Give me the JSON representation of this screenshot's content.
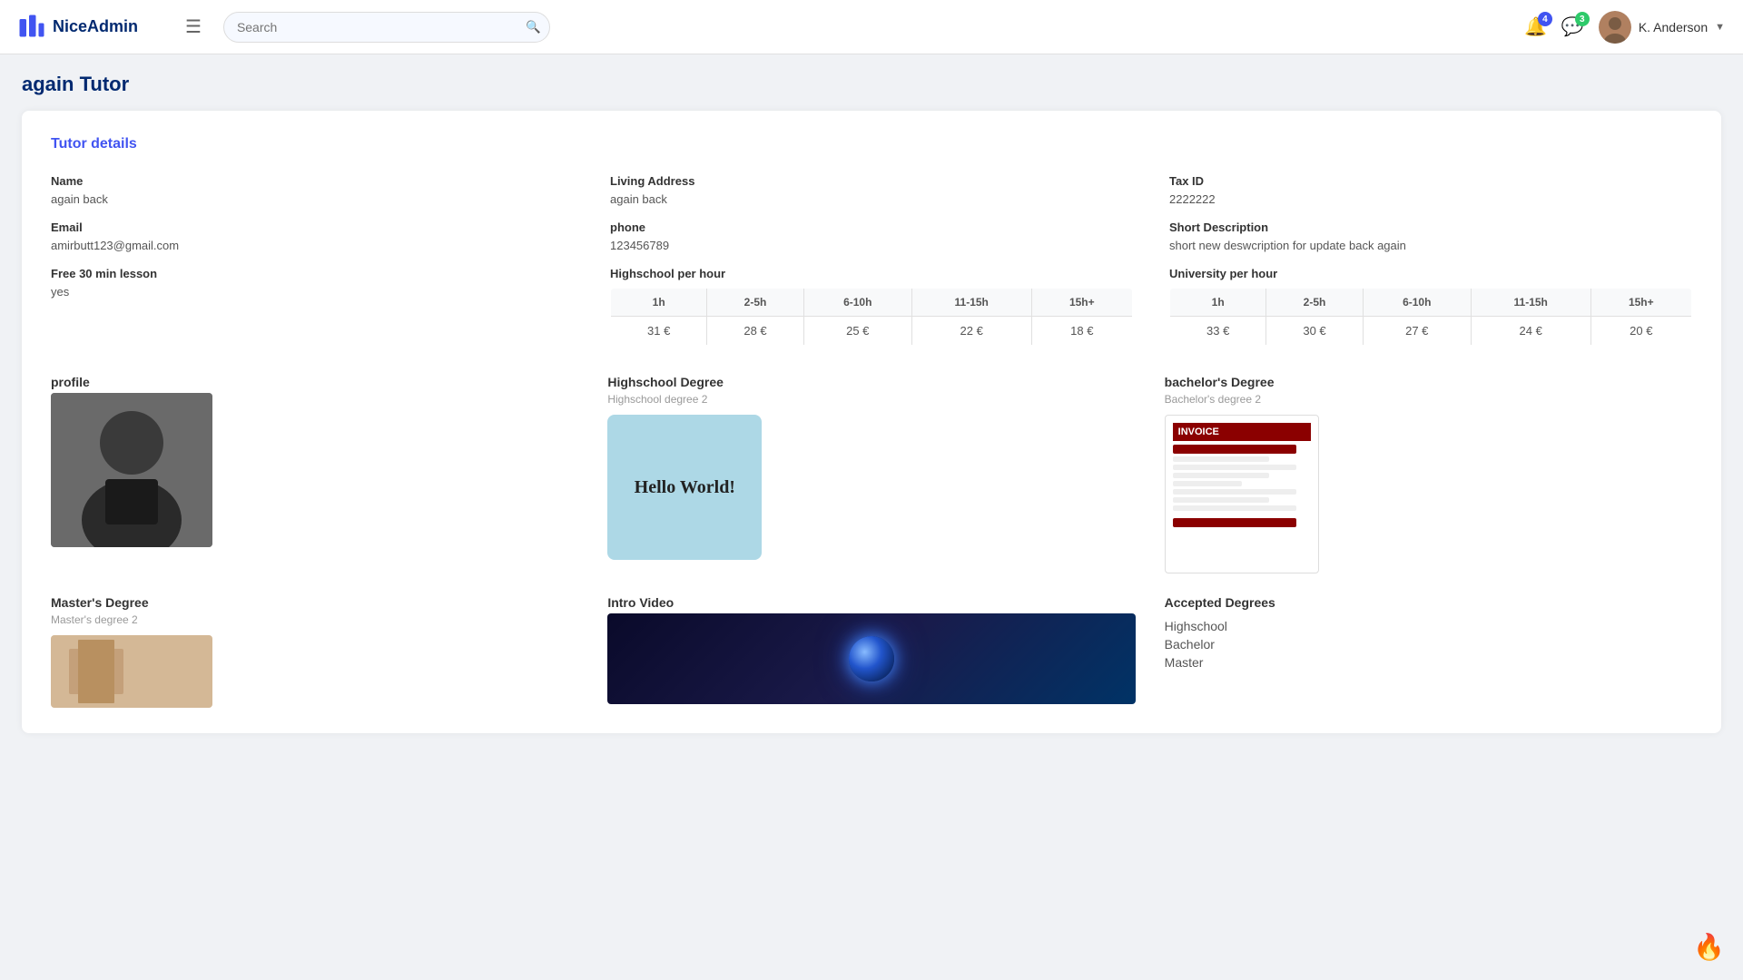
{
  "header": {
    "logo_text": "NiceAdmin",
    "search_placeholder": "Search",
    "notifications_badge": "4",
    "messages_badge": "3",
    "user_name": "K. Anderson"
  },
  "page": {
    "title": "again Tutor"
  },
  "card": {
    "title": "Tutor details"
  },
  "tutor": {
    "name_label": "Name",
    "name_value": "again back",
    "email_label": "Email",
    "email_value": "amirbutt123@gmail.com",
    "free_lesson_label": "Free 30 min lesson",
    "free_lesson_value": "yes",
    "living_address_label": "Living Address",
    "living_address_value": "again back",
    "phone_label": "phone",
    "phone_value": "123456789",
    "tax_id_label": "Tax ID",
    "tax_id_value": "2222222",
    "short_desc_label": "Short Description",
    "short_desc_value": "short new deswcription for update back again"
  },
  "highschool_pricing": {
    "label": "Highschool per hour",
    "columns": [
      "1h",
      "2-5h",
      "6-10h",
      "11-15h",
      "15h+"
    ],
    "values": [
      "31 €",
      "28 €",
      "25 €",
      "22 €",
      "18 €"
    ]
  },
  "university_pricing": {
    "label": "University per hour",
    "columns": [
      "1h",
      "2-5h",
      "6-10h",
      "11-15h",
      "15h+"
    ],
    "values": [
      "33 €",
      "30 €",
      "27 €",
      "24 €",
      "20 €"
    ]
  },
  "profile_section": {
    "label": "profile"
  },
  "highschool_degree": {
    "label": "Highschool Degree",
    "subtitle": "Highschool degree 2",
    "image_text": "Hello World!"
  },
  "bachelors_degree": {
    "label": "bachelor's Degree",
    "subtitle": "Bachelor's degree 2"
  },
  "masters_degree": {
    "label": "Master's Degree",
    "subtitle": "Master's degree 2"
  },
  "intro_video": {
    "label": "Intro Video"
  },
  "accepted_degrees": {
    "label": "Accepted Degrees",
    "items": [
      "Highschool",
      "Bachelor",
      "Master"
    ]
  },
  "fire_icon": "🔥"
}
